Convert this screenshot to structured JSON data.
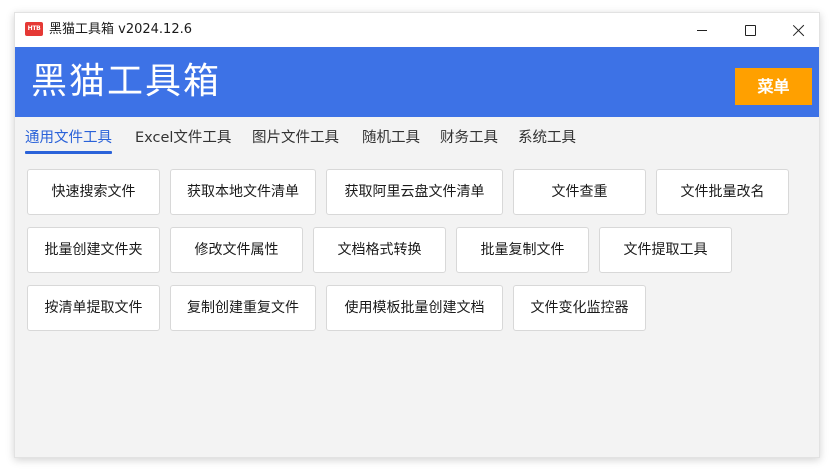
{
  "window": {
    "title": "黑猫工具箱 v2024.12.6",
    "icon_text": "HTB",
    "icon_color": "#e53935",
    "controls": [
      "minimize-icon",
      "maximize-icon",
      "close-icon"
    ]
  },
  "header": {
    "title": "黑猫工具箱",
    "menu_label": "菜单",
    "background": "#3d72e6",
    "menu_color": "#ffa000"
  },
  "tabs": [
    {
      "label": "通用文件工具",
      "active": true
    },
    {
      "label": "Excel文件工具",
      "active": false
    },
    {
      "label": "图片文件工具",
      "active": false
    },
    {
      "label": "随机工具",
      "active": false
    },
    {
      "label": "财务工具",
      "active": false
    },
    {
      "label": "系统工具",
      "active": false
    }
  ],
  "tools": {
    "row1": [
      "快速搜索文件",
      "获取本地文件清单",
      "获取阿里云盘文件清单",
      "文件查重",
      "文件批量改名"
    ],
    "row2": [
      "批量创建文件夹",
      "修改文件属性",
      "文档格式转换",
      "批量复制文件",
      "文件提取工具"
    ],
    "row3": [
      "按清单提取文件",
      "复制创建重复文件",
      "使用模板批量创建文档",
      "文件变化监控器"
    ]
  }
}
